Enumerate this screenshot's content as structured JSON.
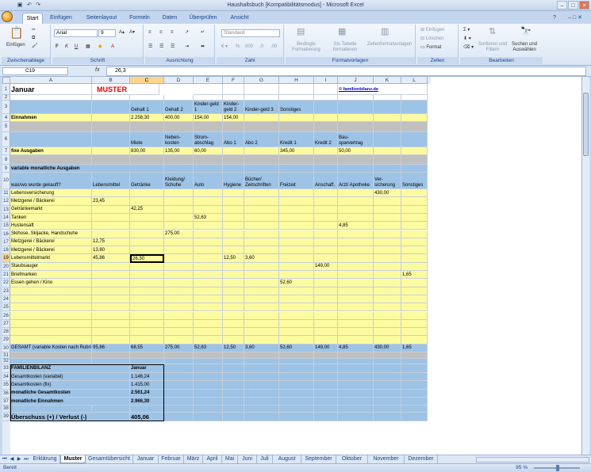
{
  "window": {
    "title": "Haushaltsbuch  [Kompatibilitätsmodus]  -  Microsoft Excel"
  },
  "ribbon_tabs": [
    "Start",
    "Einfügen",
    "Seitenlayout",
    "Formeln",
    "Daten",
    "Überprüfen",
    "Ansicht"
  ],
  "groups": {
    "clipboard": "Zwischenablage",
    "font": "Schrift",
    "alignment": "Ausrichtung",
    "number": "Zahl",
    "styles": "Formatvorlagen",
    "cells": "Zellen",
    "editing": "Bearbeiten"
  },
  "clipboard": {
    "paste": "Einfügen"
  },
  "font": {
    "name": "Arial",
    "size": "9"
  },
  "number": {
    "format": "Standard"
  },
  "styles": {
    "cond": "Bedingte Formatierung",
    "table": "Als Tabelle formatieren",
    "cellstyles": "Zellenformatvorlagen"
  },
  "cells": {
    "insert": "Einfügen",
    "delete": "Löschen",
    "format": "Format"
  },
  "editing": {
    "sort": "Sortieren und Filtern",
    "find": "Suchen und Auswählen"
  },
  "formula": {
    "namebox": "C19",
    "fx": "fx",
    "value": "26,3"
  },
  "columns": [
    "A",
    "B",
    "C",
    "D",
    "E",
    "F",
    "G",
    "H",
    "I",
    "J",
    "K",
    "L"
  ],
  "selected_column": "C",
  "selected_row": "19",
  "sheet": {
    "title": "Januar",
    "muster": "MUSTER",
    "link": "© familienbilanz.de",
    "row3": [
      "Gehalt 1",
      "Gehalt 2",
      "Kinder-geld 1",
      "Kinder-geld 2",
      "Kinder-geld 3",
      "Sonstiges"
    ],
    "income_label": "Einnahmen",
    "income_vals": [
      "2.258,30",
      "400,00",
      "154,00",
      "154,00"
    ],
    "row6": [
      "Miete",
      "Neben-kosten",
      "Strom-abschlag",
      "Abo 1",
      "Abo 2",
      "Kredit 1",
      "Kredit 2",
      "Bau-sparvertrag"
    ],
    "fixed_label": "fixe Ausgaben",
    "fixed_vals": [
      "830,00",
      "135,00",
      "60,00",
      "345,00",
      "50,00"
    ],
    "var_label": "variable monatliche Ausgaben",
    "row10": [
      "was/wo wurde gekauft?",
      "Lebensmittel",
      "Getränke",
      "Kleidung/ Schuhe",
      "Auto",
      "Hygiene",
      "Bücher/ Zeitschriften",
      "Freizeit",
      "Anschaff.",
      "Arzt/ Apotheke",
      "Ver-sicherung",
      "Sonstiges"
    ],
    "items": [
      {
        "n": "11",
        "a": "Lebensversicherung",
        "k": "430,00"
      },
      {
        "n": "12",
        "a": "Metzgerei / Bäckerei",
        "b": "23,45"
      },
      {
        "n": "13",
        "a": "Getränkemarkt",
        "c": "42,25"
      },
      {
        "n": "14",
        "a": "Tanken",
        "e": "52,63"
      },
      {
        "n": "15",
        "a": "Hustensaft",
        "j": "4,85"
      },
      {
        "n": "16",
        "a": "Skihose, Skijacke, Handschuhe",
        "d": "275,00"
      },
      {
        "n": "17",
        "a": "Metzgerei / Bäckerei",
        "b": "12,75"
      },
      {
        "n": "18",
        "a": "Metzgerei / Bäckerei",
        "b": "13,80"
      },
      {
        "n": "19",
        "a": "Lebensmittelmarkt",
        "b": "45,86",
        "c": "26,30",
        "f": "12,50",
        "g": "3,60"
      },
      {
        "n": "20",
        "a": "Staubsauger",
        "i": "149,00"
      },
      {
        "n": "21",
        "a": "Briefmarken",
        "l": "1,65"
      },
      {
        "n": "22",
        "a": "Essen gehen / Kino",
        "h": "52,60"
      }
    ],
    "empty_rows": [
      "23",
      "24",
      "25",
      "26",
      "27",
      "28",
      "29"
    ],
    "total_label": "GESAMT (variable Kosten nach Rubriken)",
    "total_vals": [
      "95,86",
      "68,55",
      "275,00",
      "52,63",
      "12,50",
      "3,60",
      "52,60",
      "149,00",
      "4,85",
      "430,00",
      "1,65"
    ],
    "summary_title": "FAMILIENBILANZ",
    "summary_month": "Januar",
    "summary": [
      {
        "n": "34",
        "label": "Gesamtkosten (variabel)",
        "val": "1.146,24"
      },
      {
        "n": "35",
        "label": "Gesamtkosten (fix)",
        "val": "1.415,00"
      },
      {
        "n": "36",
        "label": "monatliche Gesamtkosten",
        "val": "2.561,24"
      },
      {
        "n": "37",
        "label": "monatliche Einnahmen",
        "val": "2.966,30"
      }
    ],
    "result_label": "Überschuss (+) / Verlust (-)",
    "result_val": "405,06"
  },
  "sheet_tabs": [
    "Erklärung",
    "Muster",
    "Gesamtübersicht",
    "Januar",
    "Februar",
    "März",
    "April",
    "Mai",
    "Juni",
    "Juli",
    "August",
    "September",
    "Oktober",
    "November",
    "Dezember"
  ],
  "active_sheet": "Muster",
  "status": {
    "ready": "Bereit",
    "zoom": "95 %"
  }
}
